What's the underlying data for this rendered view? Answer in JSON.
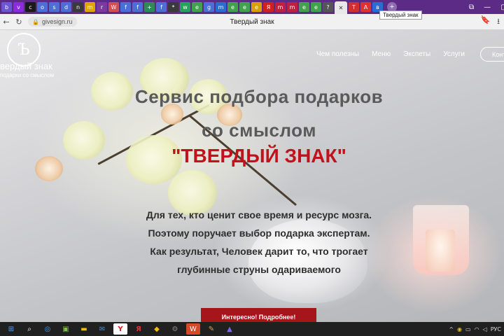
{
  "browser": {
    "tabs": [
      {
        "icon": "b",
        "color": "#6b56d3"
      },
      {
        "icon": "v",
        "color": "#8a2be2"
      },
      {
        "icon": "c",
        "color": "#1a1a1a"
      },
      {
        "icon": "o",
        "color": "#4b6fd6"
      },
      {
        "icon": "s",
        "color": "#4b6fd6"
      },
      {
        "icon": "d",
        "color": "#4b6fd6"
      },
      {
        "icon": "n",
        "color": "#3a3a3a"
      },
      {
        "icon": "m",
        "color": "#e2a400"
      },
      {
        "icon": "r",
        "color": "#7a3aa0"
      },
      {
        "icon": "W",
        "color": "#d05050"
      },
      {
        "icon": "f",
        "color": "#4b6fd6"
      },
      {
        "icon": "f",
        "color": "#4b6fd6"
      },
      {
        "icon": "+",
        "color": "#2e8b57"
      },
      {
        "icon": "f",
        "color": "#4b6fd6"
      },
      {
        "icon": "*",
        "color": "#3a3a3a"
      },
      {
        "icon": "w",
        "color": "#25a35a"
      },
      {
        "icon": "e",
        "color": "#3fa34d"
      },
      {
        "icon": "g",
        "color": "#4b6fd6"
      },
      {
        "icon": "m",
        "color": "#2a6cd6"
      },
      {
        "icon": "e",
        "color": "#3fa34d"
      },
      {
        "icon": "e",
        "color": "#3fa34d"
      },
      {
        "icon": "e",
        "color": "#d8a000"
      },
      {
        "icon": "Я",
        "color": "#d02020"
      },
      {
        "icon": "m",
        "color": "#c02040"
      },
      {
        "icon": "m",
        "color": "#c02040"
      },
      {
        "icon": "e",
        "color": "#3fa34d"
      },
      {
        "icon": "e",
        "color": "#3fa34d"
      },
      {
        "icon": "?",
        "color": "#555555"
      }
    ],
    "active_tab_close": "✕",
    "tooltip": "Твердый знак",
    "right_tabs": [
      {
        "icon": "T",
        "color": "#d03030"
      },
      {
        "icon": "A",
        "color": "#e03030"
      },
      {
        "icon": "в",
        "color": "#2a6cd6"
      }
    ],
    "new_tab": "+",
    "url": "givesign.ru",
    "page_title": "Твердый знак"
  },
  "site": {
    "logo_glyph": "Ъ",
    "brand": "вердый знак",
    "tagline": "подарки со смыслом",
    "nav": [
      "Чем полезны",
      "Меню",
      "Экспеты",
      "Услуги"
    ],
    "contact_button": "Конт",
    "headline_line1": "Сервис подбора подарков",
    "headline_line2": "со смыслом",
    "headline_brand": "\"ТВЕРДЫЙ ЗНАК\"",
    "description": [
      "Для тех, кто ценит свое время и ресурс мозга.",
      "Поэтому поручает выбор подарка экспертам.",
      "Как результат, Человек дарит то, что трогает",
      "глубинные струны одариваемого"
    ],
    "cta_button": "Интересно! Подробнее!"
  },
  "taskbar": {
    "language": "РУС"
  }
}
